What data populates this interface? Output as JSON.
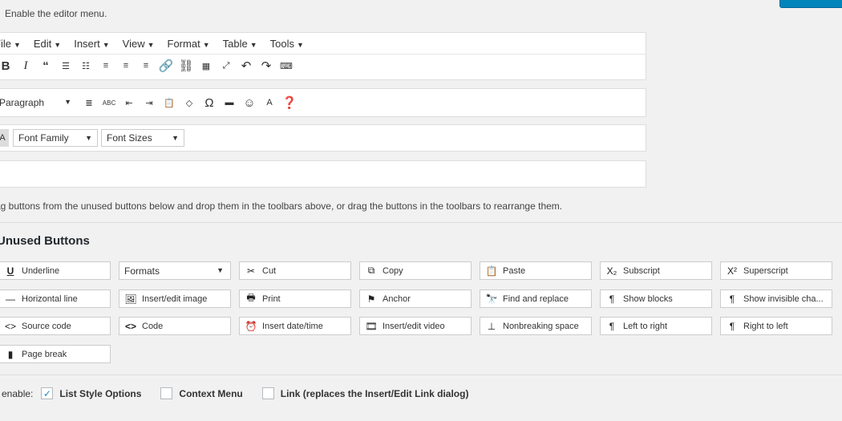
{
  "header": {
    "enable_menu_text": "Enable the editor menu."
  },
  "menu_bar": [
    {
      "label": "File",
      "x": -14
    },
    {
      "label": "Edit"
    },
    {
      "label": "Insert"
    },
    {
      "label": "View"
    },
    {
      "label": "Format"
    },
    {
      "label": "Table"
    },
    {
      "label": "Tools"
    }
  ],
  "toolbar1_icons": [
    "bold-icon",
    "italic-icon",
    "blockquote-icon",
    "bullet-list-icon",
    "numbered-list-icon",
    "align-left-icon",
    "align-center-icon",
    "align-right-icon",
    "link-icon",
    "unlink-icon",
    "table-icon",
    "fullscreen-icon",
    "undo-icon",
    "redo-icon",
    "toolbar-toggle-icon"
  ],
  "toolbar2": {
    "paragraph_label": "Paragraph"
  },
  "toolbar3": {
    "font_family": "Font Family",
    "font_sizes": "Font Sizes"
  },
  "drag_hint": "ag buttons from the unused buttons below and drop them in the toolbars above, or drag the buttons in the toolbars to rearrange them.",
  "unused": {
    "title": "Unused Buttons",
    "formats_label": "Formats",
    "buttons": [
      {
        "label": "Underline",
        "icon": "underline-icon"
      },
      {
        "label": "Cut",
        "icon": "cut-icon"
      },
      {
        "label": "Copy",
        "icon": "copy-icon"
      },
      {
        "label": "Paste",
        "icon": "paste-icon"
      },
      {
        "label": "Subscript",
        "icon": "subscript-icon"
      },
      {
        "label": "Superscript",
        "icon": "superscript-icon"
      },
      {
        "label": "Horizontal line",
        "icon": "horizontal-line-icon"
      },
      {
        "label": "Insert/edit image",
        "icon": "image-icon"
      },
      {
        "label": "Print",
        "icon": "print-icon"
      },
      {
        "label": "Anchor",
        "icon": "anchor-icon"
      },
      {
        "label": "Find and replace",
        "icon": "find-replace-icon"
      },
      {
        "label": "Show blocks",
        "icon": "show-blocks-icon"
      },
      {
        "label": "Show invisible cha...",
        "icon": "invisible-chars-icon"
      },
      {
        "label": "Source code",
        "icon": "source-code-icon"
      },
      {
        "label": "Code",
        "icon": "code-icon"
      },
      {
        "label": "Insert date/time",
        "icon": "clock-icon"
      },
      {
        "label": "Insert/edit video",
        "icon": "video-icon"
      },
      {
        "label": "Nonbreaking space",
        "icon": "nbsp-icon"
      },
      {
        "label": "Left to right",
        "icon": "ltr-icon"
      },
      {
        "label": "Right to left",
        "icon": "rtl-icon"
      },
      {
        "label": "Page break",
        "icon": "page-break-icon"
      }
    ]
  },
  "bottom": {
    "prefix": "o enable:",
    "options": [
      {
        "label": "List Style Options",
        "checked": true
      },
      {
        "label": "Context Menu",
        "checked": false
      },
      {
        "label": "Link (replaces the Insert/Edit Link dialog)",
        "checked": false
      }
    ]
  }
}
